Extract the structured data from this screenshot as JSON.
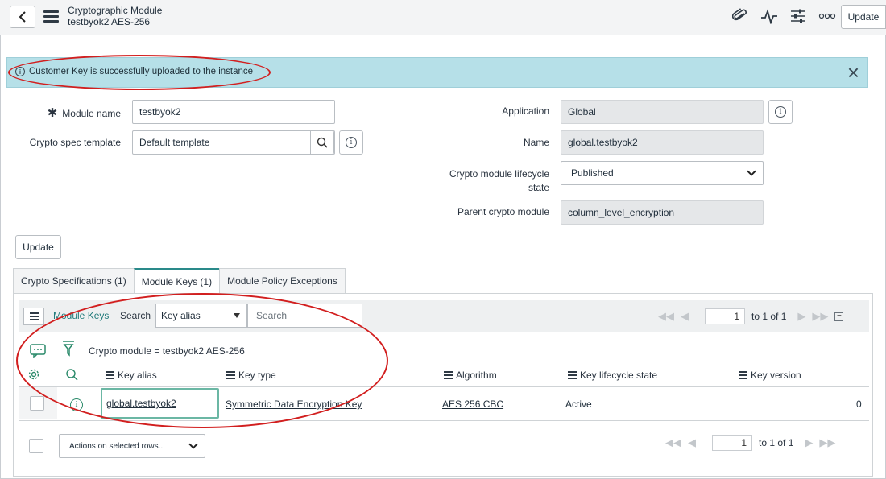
{
  "header": {
    "title_line1": "Cryptographic Module",
    "title_line2": "testbyok2 AES-256",
    "update_label": "Update",
    "icons": [
      "paperclip-icon",
      "activity-icon",
      "sliders-icon",
      "more-icon"
    ]
  },
  "alert": {
    "message": "Customer Key is successfully uploaded to the instance",
    "close_icon": "×"
  },
  "form": {
    "module_name_label": "Module name",
    "module_name_value": "testbyok2",
    "crypto_spec_label": "Crypto spec template",
    "crypto_spec_value": "Default template",
    "application_label": "Application",
    "application_value": "Global",
    "name_label": "Name",
    "name_value": "global.testbyok2",
    "lifecycle_label_1": "Crypto module lifecycle",
    "lifecycle_label_2": "state",
    "lifecycle_value": "Published",
    "parent_label": "Parent crypto module",
    "parent_value": "column_level_encryption",
    "required_mark": "✱",
    "update_label": "Update"
  },
  "tabs": [
    {
      "label": "Crypto Specifications (1)"
    },
    {
      "label": "Module Keys (1)"
    },
    {
      "label": "Module Policy Exceptions"
    }
  ],
  "list": {
    "title": "Module Keys",
    "search_label": "Search",
    "search_field": "Key alias",
    "search_placeholder": "Search",
    "page_value": "1",
    "page_text": "to 1 of 1",
    "condition": "Crypto module = testbyok2 AES-256",
    "columns": [
      "Key alias",
      "Key type",
      "Algorithm",
      "Key lifecycle state",
      "Key version"
    ],
    "rows": [
      {
        "key_alias": "global.testbyok2",
        "key_type": "Symmetric Data Encryption Key",
        "algorithm": "AES 256 CBC",
        "state": "Active",
        "version": "0"
      }
    ],
    "actions_placeholder": "Actions on selected rows..."
  },
  "colors": {
    "alert_bg": "#b6e0e8",
    "highlight": "#d21f1f",
    "accent": "#1f7a7a"
  }
}
